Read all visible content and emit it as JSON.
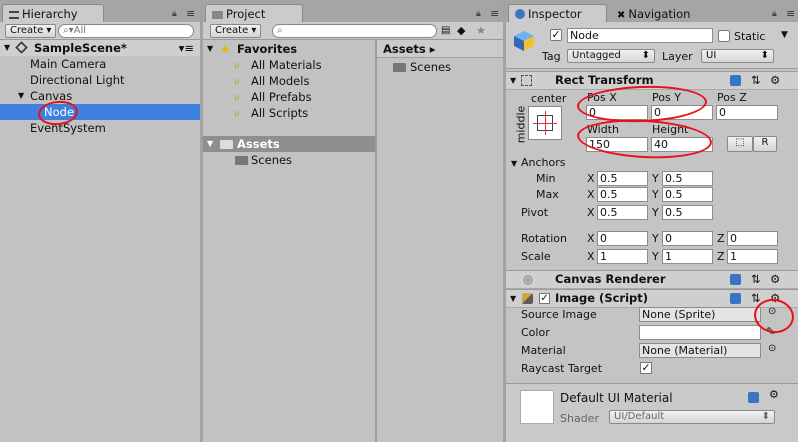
{
  "hierarchy": {
    "tab_label": "Hierarchy",
    "create_label": "Create ▾",
    "search_placeholder": "All",
    "scene_name": "SampleScene*",
    "items": [
      {
        "label": "Main Camera"
      },
      {
        "label": "Directional Light"
      },
      {
        "label": "Canvas"
      },
      {
        "label": "Node"
      },
      {
        "label": "EventSystem"
      }
    ]
  },
  "project": {
    "tab_label": "Project",
    "create_label": "Create ▾",
    "favorites_label": "Favorites",
    "favorites": [
      {
        "label": "All Materials"
      },
      {
        "label": "All Models"
      },
      {
        "label": "All Prefabs"
      },
      {
        "label": "All Scripts"
      }
    ],
    "assets_label": "Assets",
    "assets_tree": [
      {
        "label": "Scenes"
      }
    ],
    "breadcrumb": "Assets ▸",
    "assets_content": [
      {
        "label": "Scenes"
      }
    ]
  },
  "inspector": {
    "tab_label": "Inspector",
    "nav_tab_label": "Navigation",
    "object_name": "Node",
    "static_label": "Static",
    "tag_label": "Tag",
    "tag_value": "Untagged",
    "layer_label": "Layer",
    "layer_value": "UI",
    "rect_transform": {
      "title": "Rect Transform",
      "anchor_preset_h": "center",
      "anchor_preset_v": "middle",
      "pos_x_label": "Pos X",
      "pos_y_label": "Pos Y",
      "pos_z_label": "Pos Z",
      "pos_x": "0",
      "pos_y": "0",
      "pos_z": "0",
      "width_label": "Width",
      "height_label": "Height",
      "width": "150",
      "height": "40",
      "r_button": "R",
      "anchors_label": "Anchors",
      "min_label": "Min",
      "min_x": "0.5",
      "min_y": "0.5",
      "max_label": "Max",
      "max_x": "0.5",
      "max_y": "0.5",
      "pivot_label": "Pivot",
      "pivot_x": "0.5",
      "pivot_y": "0.5",
      "rotation_label": "Rotation",
      "rot_x": "0",
      "rot_y": "0",
      "rot_z": "0",
      "scale_label": "Scale",
      "scale_x": "1",
      "scale_y": "1",
      "scale_z": "1",
      "x_axis": "X",
      "y_axis": "Y",
      "z_axis": "Z"
    },
    "canvas_renderer": {
      "title": "Canvas Renderer"
    },
    "image_script": {
      "title": "Image (Script)",
      "source_image_label": "Source Image",
      "source_image_value": "None (Sprite)",
      "color_label": "Color",
      "material_label": "Material",
      "material_value": "None (Material)",
      "raycast_label": "Raycast Target"
    },
    "default_material": {
      "title": "Default UI Material",
      "shader_label": "Shader",
      "shader_value": "UI/Default"
    }
  },
  "colors": {
    "selection": "#3d80df",
    "annotation": "#e8101a"
  }
}
